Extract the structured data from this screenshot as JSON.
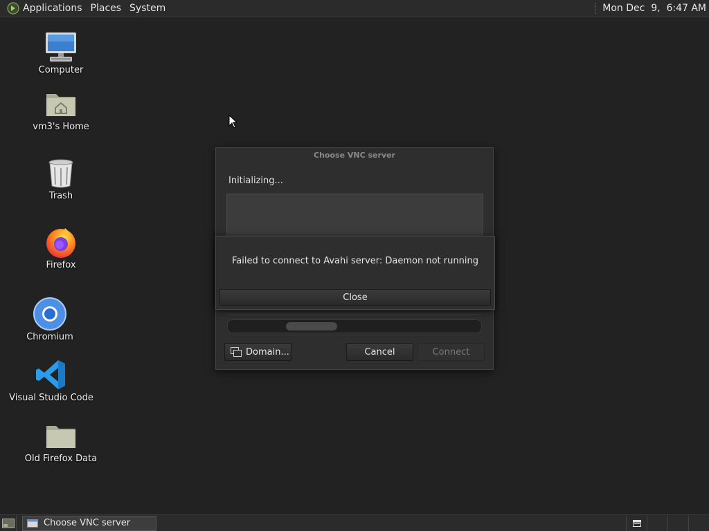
{
  "top_panel": {
    "menus": [
      "Applications",
      "Places",
      "System"
    ],
    "clock": "Mon Dec  9,  6:47 AM"
  },
  "desktop": {
    "icons": [
      {
        "label": "Computer",
        "icon": "computer-icon"
      },
      {
        "label": "vm3's Home",
        "icon": "home-folder-icon"
      },
      {
        "label": "Trash",
        "icon": "trash-icon"
      },
      {
        "label": "Firefox",
        "icon": "firefox-icon"
      },
      {
        "label": "Chromium",
        "icon": "chromium-icon"
      },
      {
        "label": "Visual Studio Code",
        "icon": "vscode-icon"
      },
      {
        "label": "Old Firefox Data",
        "icon": "folder-icon"
      }
    ]
  },
  "vnc_window": {
    "title": "Choose VNC server",
    "status": "Initializing...",
    "domain_label": "Domain...",
    "cancel_label": "Cancel",
    "connect_label": "Connect"
  },
  "error_dialog": {
    "message": "Failed to connect to Avahi server: Daemon not running",
    "close_label": "Close"
  },
  "taskbar": {
    "window_label": "Choose VNC server"
  },
  "colors": {
    "desktop_bg": "#222222",
    "panel_bg": "#2b2b2b",
    "dialog_bg": "#2e2e2e"
  }
}
